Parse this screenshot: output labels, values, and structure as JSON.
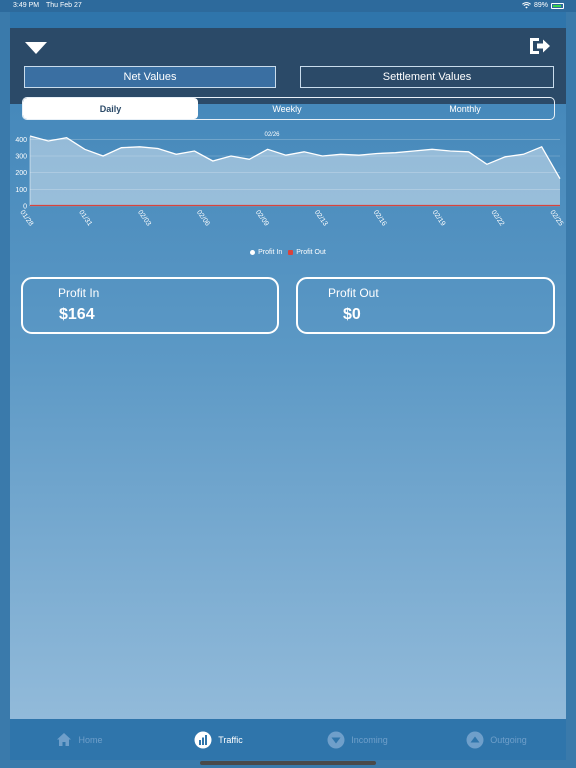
{
  "status": {
    "time": "3:49 PM",
    "date": "Thu Feb 27",
    "battery": "89%"
  },
  "colors": {
    "header": "#2b4a68",
    "tabbar": "#2f75ab",
    "profit_in": "#ffffff",
    "profit_out": "#d9433c"
  },
  "header": {
    "dropdown_icon": "triangle-down-icon",
    "logout_icon": "logout-icon",
    "net_values": "Net Values",
    "settlement_values": "Settlement Values"
  },
  "period": {
    "daily": "Daily",
    "weekly": "Weekly",
    "monthly": "Monthly",
    "selected": "Daily"
  },
  "chart_data": {
    "type": "area",
    "annotation": "02/26",
    "yticks": [
      0,
      100,
      200,
      300,
      400
    ],
    "ylim": [
      0,
      450
    ],
    "xlabels": [
      "01/28",
      "01/31",
      "02/03",
      "02/06",
      "02/09",
      "02/13",
      "02/16",
      "02/19",
      "02/22",
      "02/25"
    ],
    "series": [
      {
        "name": "Profit In",
        "color": "#ffffff",
        "values": [
          420,
          390,
          410,
          340,
          300,
          350,
          355,
          345,
          310,
          330,
          270,
          300,
          280,
          340,
          305,
          325,
          300,
          310,
          305,
          315,
          320,
          330,
          340,
          330,
          325,
          250,
          295,
          310,
          355,
          164
        ]
      },
      {
        "name": "Profit Out",
        "color": "#d9433c",
        "values": [
          0,
          0,
          0,
          0,
          0,
          0,
          0,
          0,
          0,
          0,
          0,
          0,
          0,
          0,
          0,
          0,
          0,
          0,
          0,
          0,
          0,
          0,
          0,
          0,
          0,
          0,
          0,
          0,
          0,
          0
        ]
      }
    ],
    "legend": [
      "Profit In",
      "Profit Out"
    ],
    "legend_position": "bottom-center"
  },
  "cards": {
    "profit_in": {
      "label": "Profit In",
      "value": "$164"
    },
    "profit_out": {
      "label": "Profit Out",
      "value": "$0"
    }
  },
  "tabs": [
    {
      "label": "Home",
      "icon": "home-icon"
    },
    {
      "label": "Traffic",
      "icon": "bar-chart-icon"
    },
    {
      "label": "Incoming",
      "icon": "arrow-down-circle-icon"
    },
    {
      "label": "Outgoing",
      "icon": "arrow-up-circle-icon"
    }
  ],
  "active_tab": "Traffic"
}
